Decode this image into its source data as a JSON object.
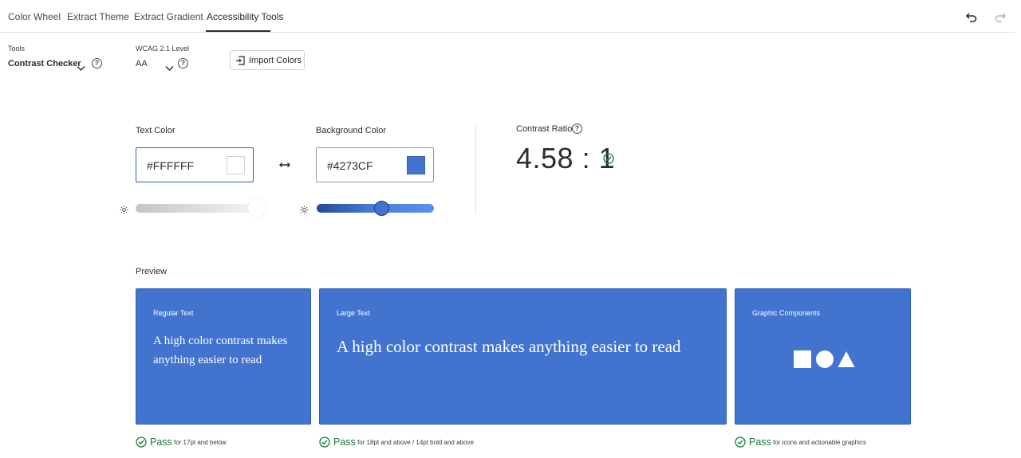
{
  "tabs": [
    {
      "label": "Color Wheel"
    },
    {
      "label": "Extract Theme"
    },
    {
      "label": "Extract Gradient"
    },
    {
      "label": "Accessibility Tools"
    }
  ],
  "toolbar": {
    "tools_label": "Tools",
    "tools_value": "Contrast Checker",
    "wcag_label": "WCAG 2.1 Level",
    "wcag_value": "AA",
    "import_label": "Import Colors",
    "help_glyph": "?"
  },
  "contrast": {
    "text_color_label": "Text Color",
    "text_color_value": "#FFFFFF",
    "background_color_label": "Background Color",
    "background_color_value": "#4273CF",
    "ratio_label": "Contrast Ratio",
    "ratio_value": "4.58 : 1",
    "text_lightness": 1.0,
    "background_lightness": 0.55
  },
  "preview": {
    "title": "Preview",
    "cards": [
      {
        "label": "Regular Text",
        "text": "A high color contrast makes anything easier to read",
        "result": "Pass",
        "note": "for 17pt and below"
      },
      {
        "label": "Large Text",
        "text": "A high color contrast makes anything easier to read",
        "result": "Pass",
        "note": "for 18pt and above / 14pt bold and above"
      },
      {
        "label": "Graphic Components",
        "text": "",
        "result": "Pass",
        "note": "for icons and actionable graphics"
      }
    ]
  },
  "colors": {
    "text_color": "#FFFFFF",
    "background_color": "#4273CF",
    "pass_green": "#1e7a3c",
    "field_border_active": "#2c5fb0"
  },
  "icons": {
    "undo": "undo-icon",
    "redo": "redo-icon",
    "swap": "swap-arrows-icon",
    "import": "import-icon",
    "brightness": "brightness-icon",
    "check": "check-circle-icon"
  }
}
